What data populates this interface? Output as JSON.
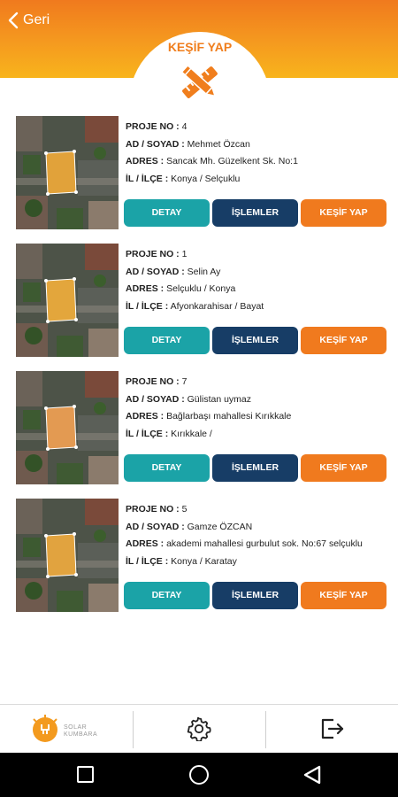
{
  "header": {
    "back_label": "Geri",
    "title": "KEŞİF YAP"
  },
  "labels": {
    "proje_no": "PROJE NO :",
    "ad_soyad": "AD / SOYAD :",
    "adres": "ADRES :",
    "il_ilce": "İL / İLÇE :"
  },
  "projects": [
    {
      "proje_no": "4",
      "ad_soyad": "Mehmet Özcan",
      "adres": "Sancak Mh. Güzelkent Sk. No:1",
      "il_ilce": "Konya / Selçuklu"
    },
    {
      "proje_no": "1",
      "ad_soyad": "Selin Ay",
      "adres": "Selçuklu / Konya",
      "il_ilce": "Afyonkarahisar / Bayat"
    },
    {
      "proje_no": "7",
      "ad_soyad": "Gülistan uymaz",
      "adres": "Bağlarbaşı mahallesi Kırıkkale",
      "il_ilce": "Kırıkkale /"
    },
    {
      "proje_no": "5",
      "ad_soyad": "Gamze ÖZCAN",
      "adres": "akademi mahallesi gurbulut sok. No:67 selçuklu",
      "il_ilce": "Konya / Karatay"
    }
  ],
  "buttons": {
    "detay": "DETAY",
    "islemler": "İŞLEMLER",
    "kesif_yap": "KEŞİF YAP"
  },
  "bottom_bar": {
    "logo_text_line1": "SOLAR",
    "logo_text_line2": "KUMBARA"
  },
  "colors": {
    "accent_orange": "#f07a1e",
    "teal": "#1ba3a7",
    "navy": "#173d66"
  }
}
